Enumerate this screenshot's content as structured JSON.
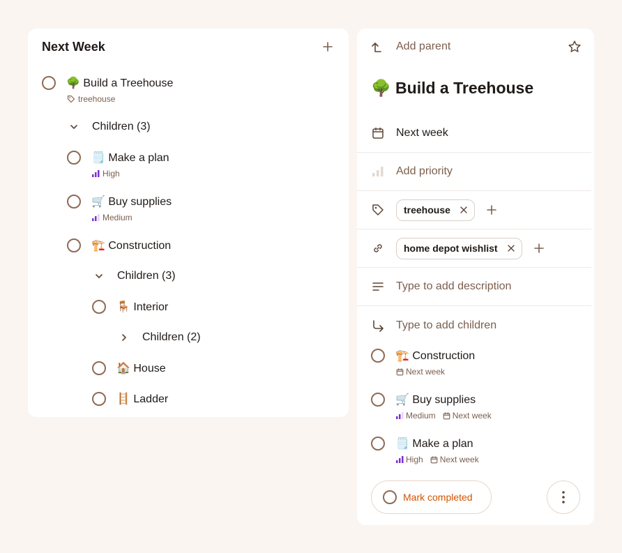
{
  "left_panel": {
    "title": "Next Week",
    "tasks": [
      {
        "emoji": "🌳",
        "title": "Build a Treehouse",
        "tag": "treehouse"
      },
      {
        "emoji": "🗒️",
        "title": "Make a plan",
        "priority": "High"
      },
      {
        "emoji": "🛒",
        "title": "Buy supplies",
        "priority": "Medium"
      },
      {
        "emoji": "🏗️",
        "title": "Construction"
      },
      {
        "emoji": "🪑",
        "title": "Interior"
      },
      {
        "emoji": "🏠",
        "title": "House"
      },
      {
        "emoji": "🪜",
        "title": "Ladder"
      }
    ],
    "children_groups": [
      "Children (3)",
      "Children (3)",
      "Children (2)"
    ]
  },
  "right_panel": {
    "add_parent": "Add parent",
    "title": "Build a Treehouse",
    "title_emoji": "🌳",
    "date": "Next week",
    "add_priority": "Add priority",
    "tag": "treehouse",
    "link": "home depot wishlist",
    "description_placeholder": "Type to add description",
    "children_placeholder": "Type to add children",
    "children": [
      {
        "emoji": "🏗️",
        "title": "Construction",
        "date": "Next week"
      },
      {
        "emoji": "🛒",
        "title": "Buy supplies",
        "priority": "Medium",
        "date": "Next week"
      },
      {
        "emoji": "🗒️",
        "title": "Make a plan",
        "priority": "High",
        "date": "Next week"
      }
    ],
    "mark_completed": "Mark completed"
  },
  "colors": {
    "accent": "#d35400",
    "priority_high": "#7b2fd1",
    "priority_dim": "#e1d4f3",
    "brown": "#8d6b55",
    "background": "#faf5f1"
  }
}
